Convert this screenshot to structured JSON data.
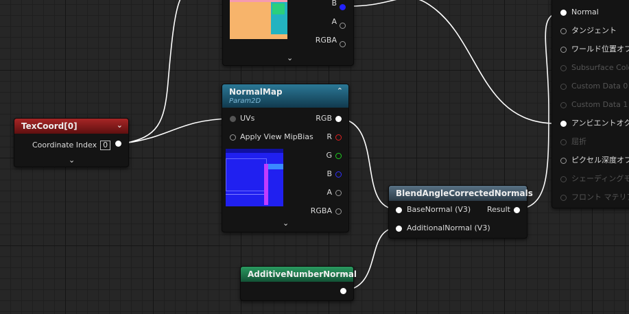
{
  "nodes": {
    "texcoord": {
      "title": "TexCoord[0]",
      "output_label": "Coordinate Index",
      "index_value": "0"
    },
    "texture_top": {
      "pins": [
        "B",
        "A",
        "RGBA"
      ]
    },
    "normalmap": {
      "title": "NormalMap",
      "subtitle": "Param2D",
      "inputs": [
        "UVs",
        "Apply View MipBias"
      ],
      "outputs": [
        "RGB",
        "R",
        "G",
        "B",
        "A",
        "RGBA"
      ]
    },
    "blend": {
      "title": "BlendAngleCorrectedNormals",
      "input_base": "BaseNormal (V3)",
      "input_additional": "AdditionalNormal (V3)",
      "output": "Result"
    },
    "additive": {
      "title": "AdditiveNumberNormal"
    },
    "material": {
      "inputs": [
        "Normal",
        "タンジェント",
        "ワールド位置オフ",
        "Subsurface Colo",
        "Custom Data 0",
        "Custom Data 1",
        "アンビエントオクル",
        "屈折",
        "ピクセル深度オフ",
        "シェーディングモデ",
        "フロント マテリアル"
      ]
    }
  },
  "icons": {
    "collapse": "chevron-down-icon",
    "collapse_up": "chevron-up-icon"
  },
  "colors": {
    "texcoord_header": "#8f1a1a",
    "normalmap_header": "#1f5f7c",
    "blend_header": "#40576a",
    "additive_header": "#1f7b4b",
    "wire": "#ffffff"
  }
}
